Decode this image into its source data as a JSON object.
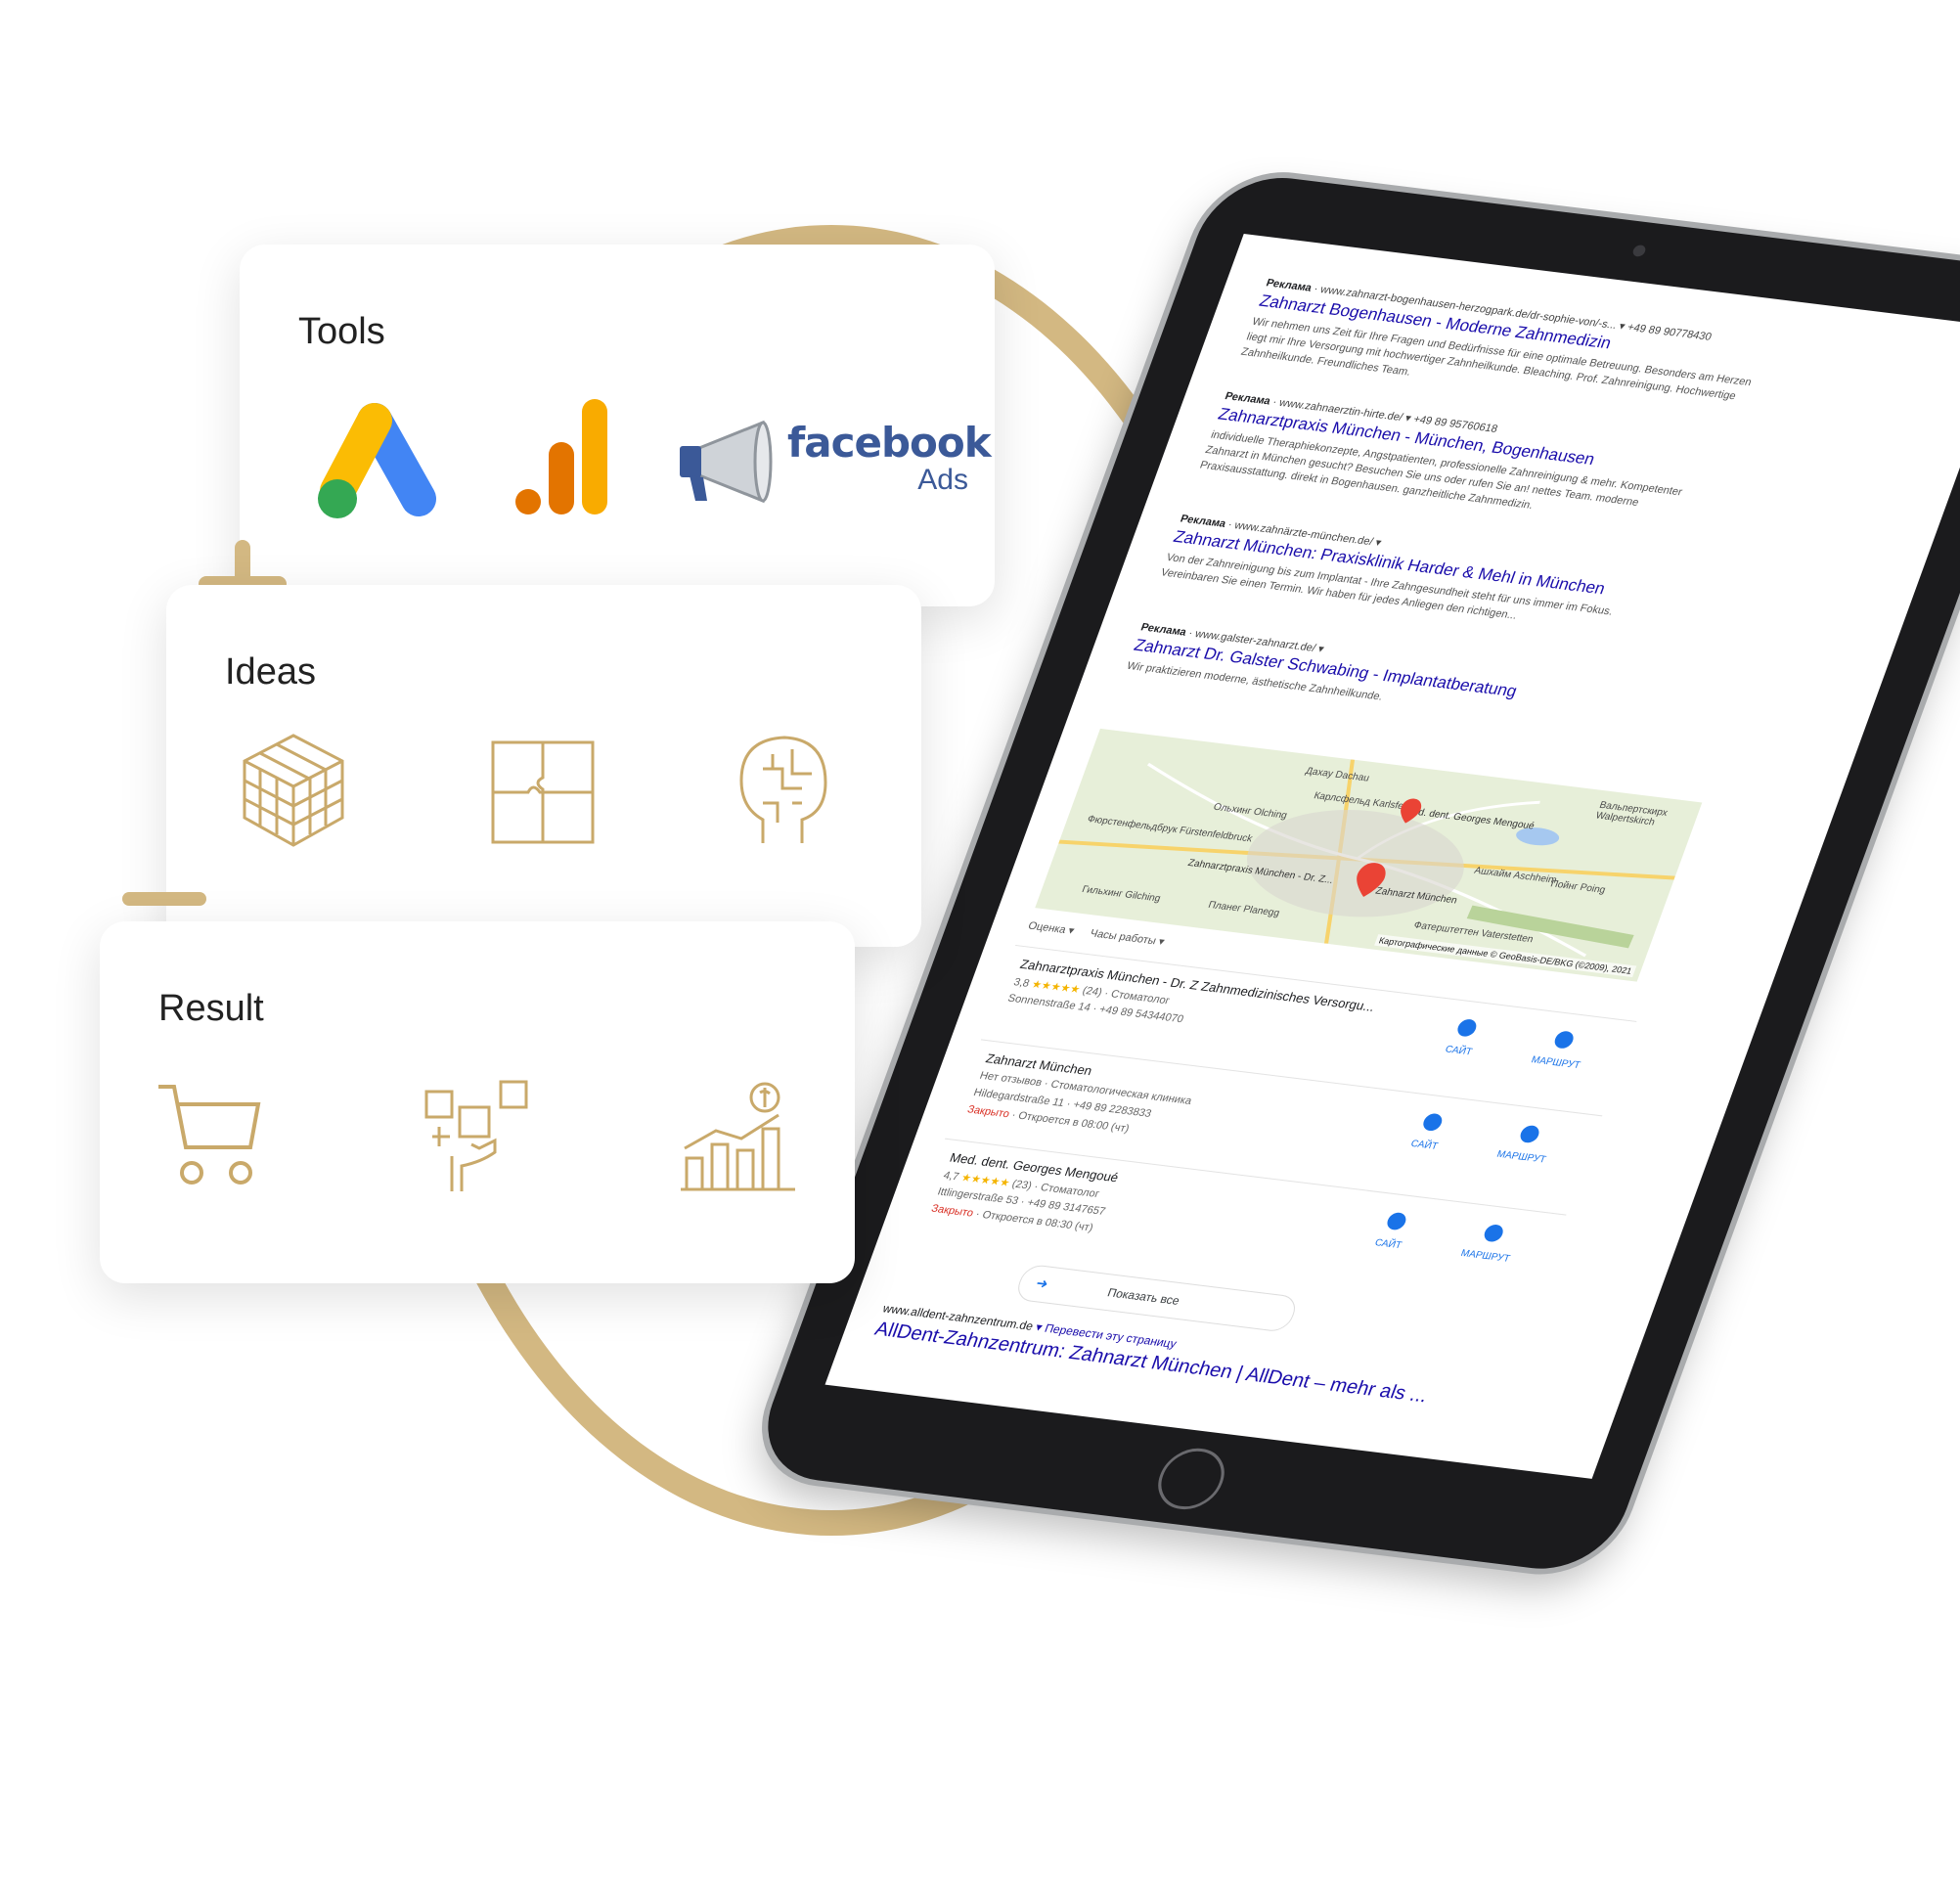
{
  "cards": {
    "tools": {
      "title": "Tools"
    },
    "ideas": {
      "title": "Ideas"
    },
    "result": {
      "title": "Result"
    }
  },
  "tools_icons": {
    "facebook_word": "facebook",
    "facebook_ads": "Ads"
  },
  "serp": {
    "ads": [
      {
        "label": "Реклама",
        "url": "www.zahnarzt-bogenhausen-herzogpark.de/dr-sophie-von/-s...",
        "phone": "+49 89 90778430",
        "title": "Zahnarzt Bogenhausen - Moderne Zahnmedizin",
        "desc": "Wir nehmen uns Zeit für Ihre Fragen und Bedürfnisse für eine optimale Betreuung. Besonders am Herzen liegt mir Ihre Versorgung mit hochwertiger Zahnheilkunde. Bleaching. Prof. Zahnreinigung. Hochwertige Zahnheilkunde. Freundliches Team."
      },
      {
        "label": "Реклама",
        "url": "www.zahnaerztin-hirte.de/",
        "phone": "+49 89 95760618",
        "title": "Zahnarztpraxis München - München, Bogenhausen",
        "desc": "individuelle Theraphiekonzepte, Angstpatienten, professionelle Zahnreinigung & mehr. Kompetenter Zahnarzt in München gesucht? Besuchen Sie uns oder rufen Sie an! nettes Team. moderne Praxisausstattung. direkt in Bogenhausen. ganzheitliche Zahnmedizin."
      },
      {
        "label": "Реклама",
        "url": "www.zahnärzte-münchen.de/",
        "phone": "",
        "title": "Zahnarzt München: Praxisklinik Harder & Mehl in München",
        "desc": "Von der Zahnreinigung bis zum Implantat - Ihre Zahngesundheit steht für uns immer im Fokus. Vereinbaren Sie einen Termin. Wir haben für jedes Anliegen den richtigen..."
      },
      {
        "label": "Реклама",
        "url": "www.galster-zahnarzt.de/",
        "phone": "",
        "title": "Zahnarzt Dr. Galster Schwabing - Implantatberatung",
        "desc": "Wir praktizieren moderne, ästhetische Zahnheilkunde."
      }
    ],
    "map": {
      "credit": "Картографические данные © GeoBasis-DE/BKG (©2009), 2021",
      "labels": [
        "Дахау Dachau",
        "Карлсфельд Karlsfeld",
        "Ольхинг Olching",
        "Фюрстенфельдбрук Fürstenfeldbruck",
        "Zahnarztpraxis München - Dr. Z...",
        "Zahnarzt München",
        "Med. dent. Georges Mengoué",
        "Ашхайм Aschheim",
        "Пойнг Poing",
        "Гильхинг Gilching",
        "Планег Planegg",
        "Фатерштеттен Vaterstetten",
        "Вальпертскирх Walpertskirch"
      ]
    },
    "filters": [
      "Оценка ▾",
      "Часы работы ▾"
    ],
    "places": [
      {
        "name": "Zahnarztpraxis München - Dr. Z Zahnmedizinisches Versorgu...",
        "rating": "3,8",
        "stars": "★★★★★",
        "reviews": "(24)",
        "type": "Стоматолог",
        "address": "Sonnenstraße 14 · +49 89 54344070",
        "status": "",
        "hours": "",
        "site": "САЙТ",
        "route": "МАРШРУТ"
      },
      {
        "name": "Zahnarzt München",
        "rating": "",
        "stars": "",
        "reviews": "Нет отзывов",
        "type": "Стоматологическая клиника",
        "address": "Hildegardstraße 11 · +49 89 2283833",
        "status": "Закрыто",
        "hours": "· Откроется в 08:00 (чт)",
        "site": "САЙТ",
        "route": "МАРШРУТ"
      },
      {
        "name": "Med. dent. Georges Mengoué",
        "rating": "4,7",
        "stars": "★★★★★",
        "reviews": "(23)",
        "type": "Стоматолог",
        "address": "Ittlingerstraße 53 · +49 89 3147657",
        "status": "Закрыто",
        "hours": "· Откроется в 08:30 (чт)",
        "site": "САЙТ",
        "route": "МАРШРУТ"
      }
    ],
    "show_all": "Показать все",
    "organic": {
      "url": "www.alldent-zahnzentrum.de",
      "translate": "▾  Перевести эту страницу",
      "title": "AllDent-Zahnzentrum: Zahnarzt München | AllDent – mehr als ..."
    }
  },
  "colors": {
    "gold": "#d3b882",
    "link": "#1a0dab",
    "fb_blue": "#3b5998"
  },
  "icon_names": [
    "google-ads-icon",
    "google-analytics-icon",
    "megaphone-icon",
    "cube-icon",
    "puzzle-icon",
    "brain-head-icon",
    "shopping-cart-icon",
    "social-media-hand-icon",
    "growth-chart-icon",
    "plus-icon",
    "equals-icon"
  ]
}
